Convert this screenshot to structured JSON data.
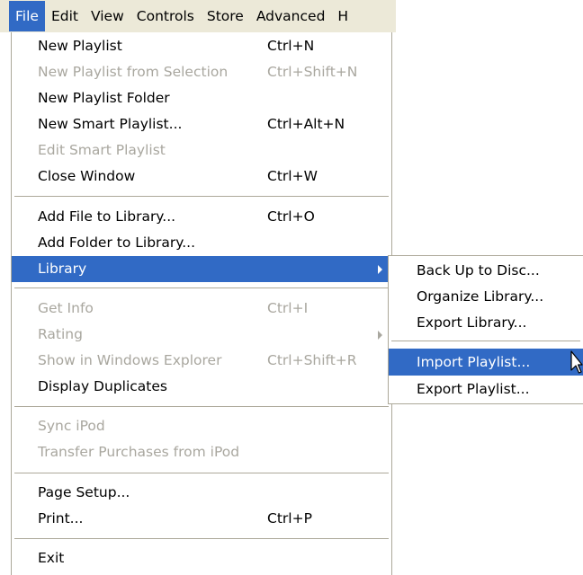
{
  "menubar": {
    "items": [
      "File",
      "Edit",
      "View",
      "Controls",
      "Store",
      "Advanced",
      "H"
    ],
    "open_item": "File"
  },
  "file_menu": {
    "items": [
      {
        "label": "New Playlist",
        "shortcut": "Ctrl+N",
        "enabled": true
      },
      {
        "label": "New Playlist from Selection",
        "shortcut": "Ctrl+Shift+N",
        "enabled": false
      },
      {
        "label": "New Playlist Folder",
        "shortcut": "",
        "enabled": true
      },
      {
        "label": "New Smart Playlist...",
        "shortcut": "Ctrl+Alt+N",
        "enabled": true
      },
      {
        "label": "Edit Smart Playlist",
        "shortcut": "",
        "enabled": false
      },
      {
        "label": "Close Window",
        "shortcut": "Ctrl+W",
        "enabled": true
      },
      {
        "label": "Add File to Library...",
        "shortcut": "Ctrl+O",
        "enabled": true
      },
      {
        "label": "Add Folder to Library...",
        "shortcut": "",
        "enabled": true
      },
      {
        "label": "Library",
        "shortcut": "",
        "enabled": true,
        "submenu": true,
        "highlighted": true
      },
      {
        "label": "Get Info",
        "shortcut": "Ctrl+I",
        "enabled": false
      },
      {
        "label": "Rating",
        "shortcut": "",
        "enabled": false,
        "submenu": true
      },
      {
        "label": "Show in Windows Explorer",
        "shortcut": "Ctrl+Shift+R",
        "enabled": false
      },
      {
        "label": "Display Duplicates",
        "shortcut": "",
        "enabled": true
      },
      {
        "label": "Sync iPod",
        "shortcut": "",
        "enabled": false
      },
      {
        "label": "Transfer Purchases from iPod",
        "shortcut": "",
        "enabled": false
      },
      {
        "label": "Page Setup...",
        "shortcut": "",
        "enabled": true
      },
      {
        "label": "Print...",
        "shortcut": "Ctrl+P",
        "enabled": true
      },
      {
        "label": "Exit",
        "shortcut": "",
        "enabled": true
      }
    ]
  },
  "library_submenu": {
    "items": [
      {
        "label": "Back Up to Disc...",
        "highlighted": false
      },
      {
        "label": "Organize Library...",
        "highlighted": false
      },
      {
        "label": "Export Library...",
        "highlighted": false
      },
      {
        "label": "Import Playlist...",
        "highlighted": true
      },
      {
        "label": "Export Playlist...",
        "highlighted": false
      }
    ]
  },
  "colors": {
    "highlight": "#316ac5",
    "menubar_bg": "#ece9d8",
    "disabled_text": "#a9a79f",
    "separator": "#aca899"
  }
}
